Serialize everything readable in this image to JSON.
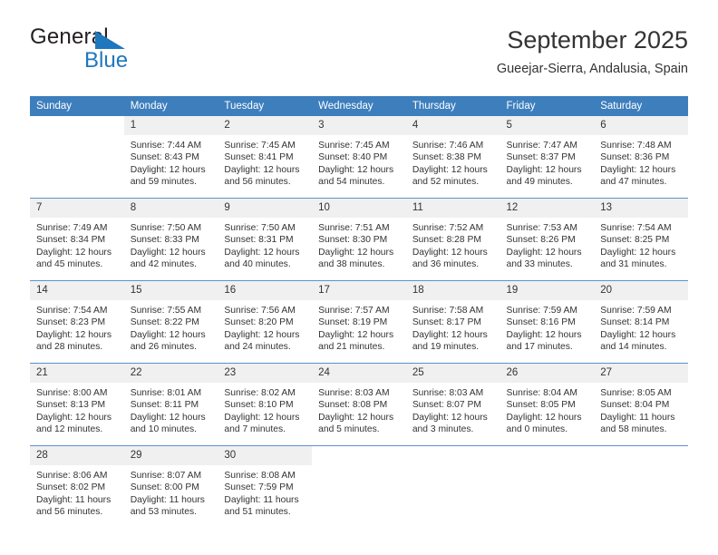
{
  "brand": {
    "name_part1": "General",
    "name_part2": "Blue",
    "accent_color": "#1f77bd",
    "logo_icon": "triangle-logo-icon"
  },
  "header": {
    "title": "September 2025",
    "subtitle": "Gueejar-Sierra, Andalusia, Spain"
  },
  "calendar": {
    "header_bg": "#3d7ebd",
    "daynum_bg": "#f0f0f0",
    "row_divider": "#5b92c9",
    "weekday_headers": [
      "Sunday",
      "Monday",
      "Tuesday",
      "Wednesday",
      "Thursday",
      "Friday",
      "Saturday"
    ],
    "weeks": [
      [
        {
          "day": "",
          "blank": true
        },
        {
          "day": "1",
          "sunrise": "Sunrise: 7:44 AM",
          "sunset": "Sunset: 8:43 PM",
          "daylight_1": "Daylight: 12 hours",
          "daylight_2": "and 59 minutes."
        },
        {
          "day": "2",
          "sunrise": "Sunrise: 7:45 AM",
          "sunset": "Sunset: 8:41 PM",
          "daylight_1": "Daylight: 12 hours",
          "daylight_2": "and 56 minutes."
        },
        {
          "day": "3",
          "sunrise": "Sunrise: 7:45 AM",
          "sunset": "Sunset: 8:40 PM",
          "daylight_1": "Daylight: 12 hours",
          "daylight_2": "and 54 minutes."
        },
        {
          "day": "4",
          "sunrise": "Sunrise: 7:46 AM",
          "sunset": "Sunset: 8:38 PM",
          "daylight_1": "Daylight: 12 hours",
          "daylight_2": "and 52 minutes."
        },
        {
          "day": "5",
          "sunrise": "Sunrise: 7:47 AM",
          "sunset": "Sunset: 8:37 PM",
          "daylight_1": "Daylight: 12 hours",
          "daylight_2": "and 49 minutes."
        },
        {
          "day": "6",
          "sunrise": "Sunrise: 7:48 AM",
          "sunset": "Sunset: 8:36 PM",
          "daylight_1": "Daylight: 12 hours",
          "daylight_2": "and 47 minutes."
        }
      ],
      [
        {
          "day": "7",
          "sunrise": "Sunrise: 7:49 AM",
          "sunset": "Sunset: 8:34 PM",
          "daylight_1": "Daylight: 12 hours",
          "daylight_2": "and 45 minutes."
        },
        {
          "day": "8",
          "sunrise": "Sunrise: 7:50 AM",
          "sunset": "Sunset: 8:33 PM",
          "daylight_1": "Daylight: 12 hours",
          "daylight_2": "and 42 minutes."
        },
        {
          "day": "9",
          "sunrise": "Sunrise: 7:50 AM",
          "sunset": "Sunset: 8:31 PM",
          "daylight_1": "Daylight: 12 hours",
          "daylight_2": "and 40 minutes."
        },
        {
          "day": "10",
          "sunrise": "Sunrise: 7:51 AM",
          "sunset": "Sunset: 8:30 PM",
          "daylight_1": "Daylight: 12 hours",
          "daylight_2": "and 38 minutes."
        },
        {
          "day": "11",
          "sunrise": "Sunrise: 7:52 AM",
          "sunset": "Sunset: 8:28 PM",
          "daylight_1": "Daylight: 12 hours",
          "daylight_2": "and 36 minutes."
        },
        {
          "day": "12",
          "sunrise": "Sunrise: 7:53 AM",
          "sunset": "Sunset: 8:26 PM",
          "daylight_1": "Daylight: 12 hours",
          "daylight_2": "and 33 minutes."
        },
        {
          "day": "13",
          "sunrise": "Sunrise: 7:54 AM",
          "sunset": "Sunset: 8:25 PM",
          "daylight_1": "Daylight: 12 hours",
          "daylight_2": "and 31 minutes."
        }
      ],
      [
        {
          "day": "14",
          "sunrise": "Sunrise: 7:54 AM",
          "sunset": "Sunset: 8:23 PM",
          "daylight_1": "Daylight: 12 hours",
          "daylight_2": "and 28 minutes."
        },
        {
          "day": "15",
          "sunrise": "Sunrise: 7:55 AM",
          "sunset": "Sunset: 8:22 PM",
          "daylight_1": "Daylight: 12 hours",
          "daylight_2": "and 26 minutes."
        },
        {
          "day": "16",
          "sunrise": "Sunrise: 7:56 AM",
          "sunset": "Sunset: 8:20 PM",
          "daylight_1": "Daylight: 12 hours",
          "daylight_2": "and 24 minutes."
        },
        {
          "day": "17",
          "sunrise": "Sunrise: 7:57 AM",
          "sunset": "Sunset: 8:19 PM",
          "daylight_1": "Daylight: 12 hours",
          "daylight_2": "and 21 minutes."
        },
        {
          "day": "18",
          "sunrise": "Sunrise: 7:58 AM",
          "sunset": "Sunset: 8:17 PM",
          "daylight_1": "Daylight: 12 hours",
          "daylight_2": "and 19 minutes."
        },
        {
          "day": "19",
          "sunrise": "Sunrise: 7:59 AM",
          "sunset": "Sunset: 8:16 PM",
          "daylight_1": "Daylight: 12 hours",
          "daylight_2": "and 17 minutes."
        },
        {
          "day": "20",
          "sunrise": "Sunrise: 7:59 AM",
          "sunset": "Sunset: 8:14 PM",
          "daylight_1": "Daylight: 12 hours",
          "daylight_2": "and 14 minutes."
        }
      ],
      [
        {
          "day": "21",
          "sunrise": "Sunrise: 8:00 AM",
          "sunset": "Sunset: 8:13 PM",
          "daylight_1": "Daylight: 12 hours",
          "daylight_2": "and 12 minutes."
        },
        {
          "day": "22",
          "sunrise": "Sunrise: 8:01 AM",
          "sunset": "Sunset: 8:11 PM",
          "daylight_1": "Daylight: 12 hours",
          "daylight_2": "and 10 minutes."
        },
        {
          "day": "23",
          "sunrise": "Sunrise: 8:02 AM",
          "sunset": "Sunset: 8:10 PM",
          "daylight_1": "Daylight: 12 hours",
          "daylight_2": "and 7 minutes."
        },
        {
          "day": "24",
          "sunrise": "Sunrise: 8:03 AM",
          "sunset": "Sunset: 8:08 PM",
          "daylight_1": "Daylight: 12 hours",
          "daylight_2": "and 5 minutes."
        },
        {
          "day": "25",
          "sunrise": "Sunrise: 8:03 AM",
          "sunset": "Sunset: 8:07 PM",
          "daylight_1": "Daylight: 12 hours",
          "daylight_2": "and 3 minutes."
        },
        {
          "day": "26",
          "sunrise": "Sunrise: 8:04 AM",
          "sunset": "Sunset: 8:05 PM",
          "daylight_1": "Daylight: 12 hours",
          "daylight_2": "and 0 minutes."
        },
        {
          "day": "27",
          "sunrise": "Sunrise: 8:05 AM",
          "sunset": "Sunset: 8:04 PM",
          "daylight_1": "Daylight: 11 hours",
          "daylight_2": "and 58 minutes."
        }
      ],
      [
        {
          "day": "28",
          "sunrise": "Sunrise: 8:06 AM",
          "sunset": "Sunset: 8:02 PM",
          "daylight_1": "Daylight: 11 hours",
          "daylight_2": "and 56 minutes."
        },
        {
          "day": "29",
          "sunrise": "Sunrise: 8:07 AM",
          "sunset": "Sunset: 8:00 PM",
          "daylight_1": "Daylight: 11 hours",
          "daylight_2": "and 53 minutes."
        },
        {
          "day": "30",
          "sunrise": "Sunrise: 8:08 AM",
          "sunset": "Sunset: 7:59 PM",
          "daylight_1": "Daylight: 11 hours",
          "daylight_2": "and 51 minutes."
        },
        {
          "day": "",
          "blank": true
        },
        {
          "day": "",
          "blank": true
        },
        {
          "day": "",
          "blank": true
        },
        {
          "day": "",
          "blank": true
        }
      ]
    ]
  }
}
